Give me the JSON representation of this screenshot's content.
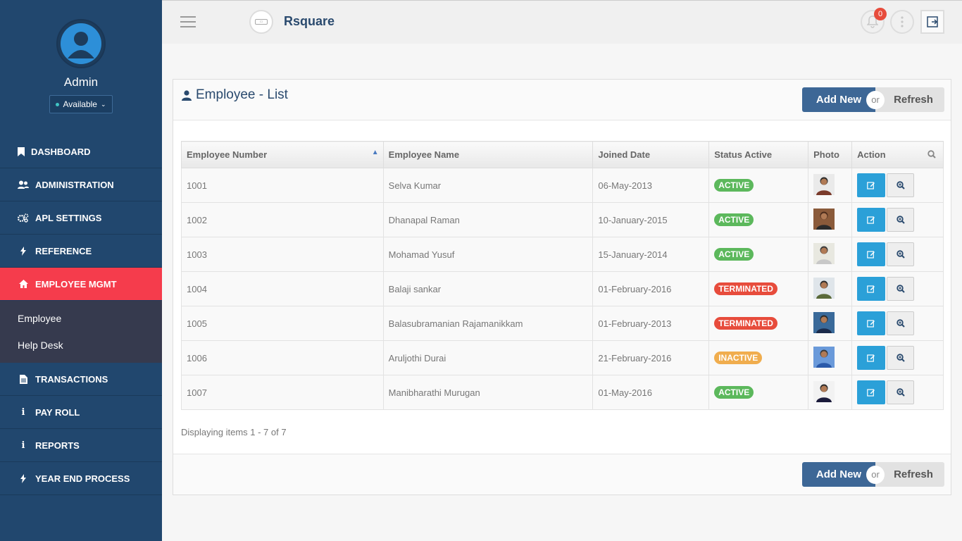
{
  "sidebar": {
    "user_name": "Admin",
    "status_label": "Available",
    "menu": [
      {
        "label": "DASHBOARD",
        "icon": "bookmark-icon"
      },
      {
        "label": "ADMINISTRATION",
        "icon": "users-icon"
      },
      {
        "label": "APL SETTINGS",
        "icon": "cogs-icon"
      },
      {
        "label": "REFERENCE",
        "icon": "bolt-icon"
      },
      {
        "label": "EMPLOYEE MGMT",
        "icon": "home-icon"
      },
      {
        "label": "TRANSACTIONS",
        "icon": "file-icon"
      },
      {
        "label": "PAY ROLL",
        "icon": "info-icon"
      },
      {
        "label": "REPORTS",
        "icon": "info-icon"
      },
      {
        "label": "YEAR END PROCESS",
        "icon": "bolt-icon"
      }
    ],
    "submenu": [
      {
        "label": "Employee"
      },
      {
        "label": "Help Desk"
      }
    ]
  },
  "header": {
    "brand": "Rsquare",
    "notification_count": "0"
  },
  "panel": {
    "title": "Employee - List",
    "add_label": "Add New",
    "or_label": "or",
    "refresh_label": "Refresh",
    "footer_info": "Displaying items 1 - 7 of 7"
  },
  "table": {
    "columns": [
      "Employee Number",
      "Employee Name",
      "Joined Date",
      "Status Active",
      "Photo",
      "Action"
    ],
    "rows": [
      {
        "num": "1001",
        "name": "Selva Kumar",
        "date": "06-May-2013",
        "status": "ACTIVE"
      },
      {
        "num": "1002",
        "name": "Dhanapal Raman",
        "date": "10-January-2015",
        "status": "ACTIVE"
      },
      {
        "num": "1003",
        "name": "Mohamad Yusuf",
        "date": "15-January-2014",
        "status": "ACTIVE"
      },
      {
        "num": "1004",
        "name": "Balaji sankar",
        "date": "01-February-2016",
        "status": "TERMINATED"
      },
      {
        "num": "1005",
        "name": "Balasubramanian Rajamanikkam",
        "date": "01-February-2013",
        "status": "TERMINATED"
      },
      {
        "num": "1006",
        "name": "Aruljothi Durai",
        "date": "21-February-2016",
        "status": "INACTIVE"
      },
      {
        "num": "1007",
        "name": "Manibharathi Murugan",
        "date": "01-May-2016",
        "status": "ACTIVE"
      }
    ]
  },
  "colors": {
    "sidebar_bg": "#21476e",
    "active_menu": "#f53c4c",
    "status_active": "#5cb85c",
    "status_terminated": "#e74c3c",
    "status_inactive": "#f0ad4e",
    "primary_button": "#3d6796",
    "edit_button": "#2ba0d8"
  }
}
